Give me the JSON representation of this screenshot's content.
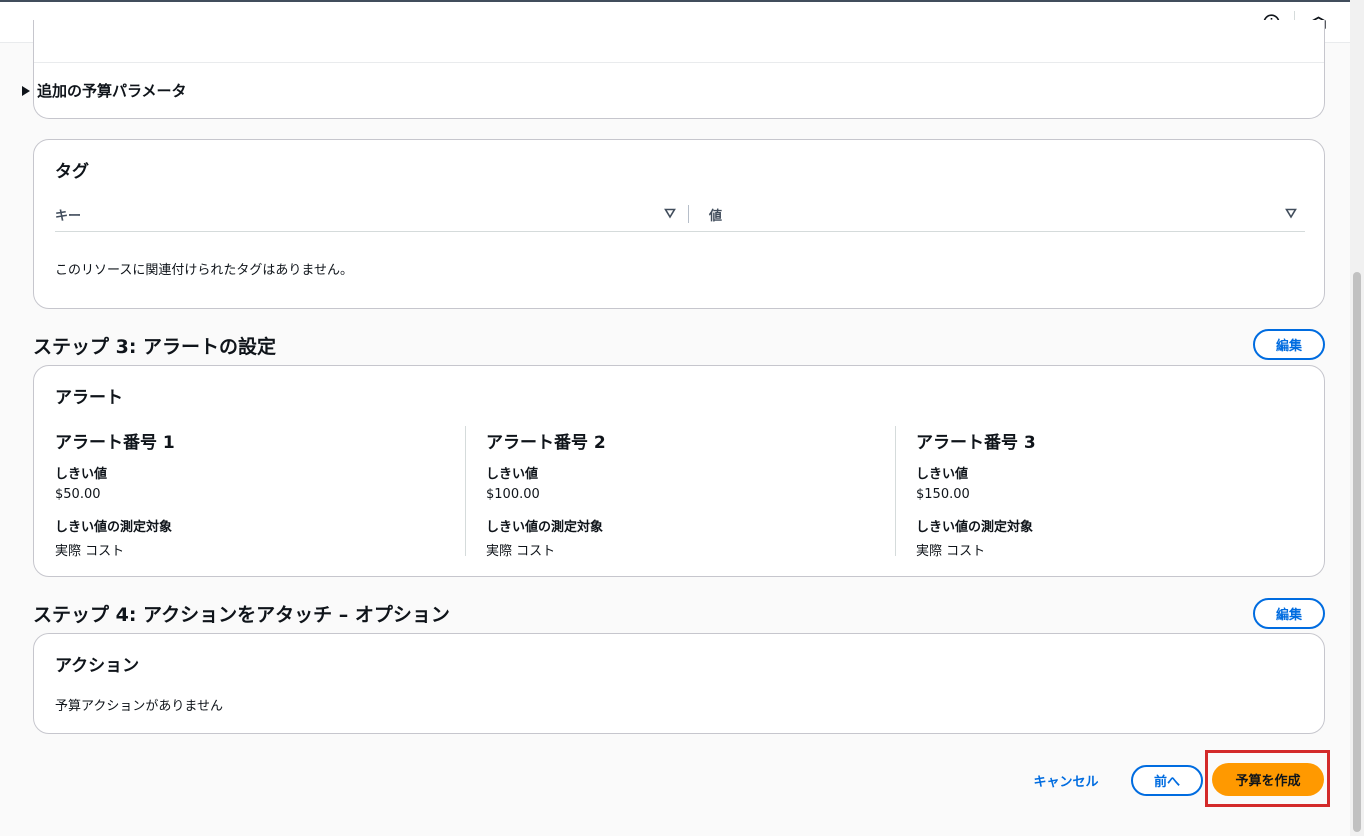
{
  "toolbar": {
    "icons": [
      "info-icon",
      "cloudshell-icon"
    ]
  },
  "params": {
    "expander_label": "追加の予算パラメータ"
  },
  "tags": {
    "title": "タグ",
    "col_key": "キー",
    "col_value": "値",
    "empty": "このリソースに関連付けられたタグはありません。"
  },
  "step3": {
    "heading": "ステップ 3: アラートの設定",
    "edit_label": "編集",
    "card_title": "アラート",
    "alerts": [
      {
        "title": "アラート番号 1",
        "threshold_label": "しきい値",
        "threshold_value": "$50.00",
        "measure_label": "しきい値の測定対象",
        "measure_value": "実際 コスト"
      },
      {
        "title": "アラート番号 2",
        "threshold_label": "しきい値",
        "threshold_value": "$100.00",
        "measure_label": "しきい値の測定対象",
        "measure_value": "実際 コスト"
      },
      {
        "title": "アラート番号 3",
        "threshold_label": "しきい値",
        "threshold_value": "$150.00",
        "measure_label": "しきい値の測定対象",
        "measure_value": "実際 コスト"
      }
    ]
  },
  "step4": {
    "heading": "ステップ 4: アクションをアタッチ – オプション",
    "edit_label": "編集",
    "card_title": "アクション",
    "empty": "予算アクションがありません"
  },
  "footer": {
    "cancel_label": "キャンセル",
    "prev_label": "前へ",
    "create_label": "予算を作成"
  },
  "colors": {
    "primary": "#006ce0",
    "cta": "#ff9900",
    "highlight": "#d32a2a"
  }
}
